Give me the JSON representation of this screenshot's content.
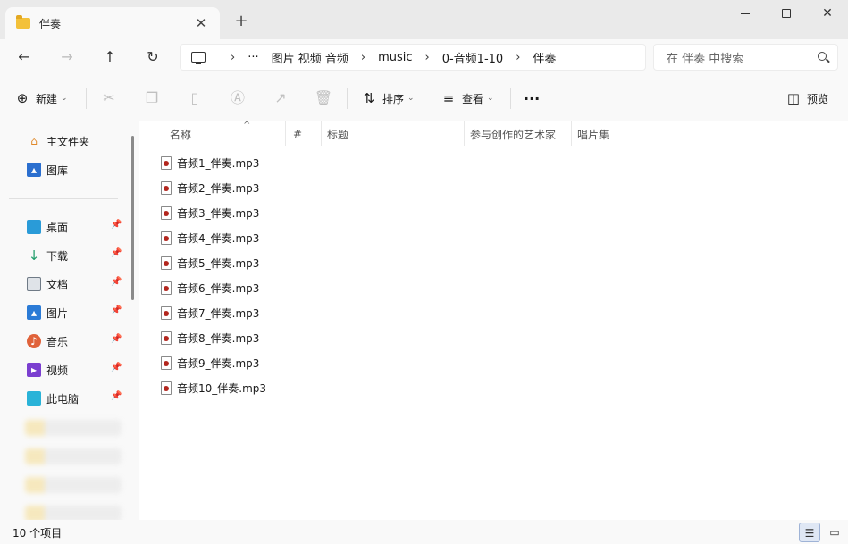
{
  "window": {
    "tab_title": "伴奏",
    "tab_close": "✕",
    "new_tab": "+",
    "minimize": "",
    "maximize": "",
    "close": "✕"
  },
  "nav": {
    "back": "←",
    "forward": "→",
    "up": "↑",
    "refresh": "↻",
    "breadcrumbs": [
      "图片 视频 音频",
      "music",
      "0-音频1-10",
      "伴奏"
    ],
    "overflow": "···",
    "search_placeholder": "在 伴奏 中搜索"
  },
  "toolbar": {
    "new_label": "新建",
    "sort_label": "排序",
    "view_label": "查看",
    "more": "···",
    "preview_label": "预览"
  },
  "sidebar": {
    "top_items": [
      {
        "label": "主文件夹",
        "icon": "home-icon",
        "color": "#e0892b"
      },
      {
        "label": "图库",
        "icon": "gallery-icon",
        "color": "#2b6fcf"
      }
    ],
    "pinned_items": [
      {
        "label": "桌面",
        "icon": "desktop-icon",
        "color": "#2a9bd8"
      },
      {
        "label": "下载",
        "icon": "download-icon",
        "color": "#1f9d6a"
      },
      {
        "label": "文档",
        "icon": "document-icon",
        "color": "#6f7a86"
      },
      {
        "label": "图片",
        "icon": "pictures-icon",
        "color": "#2b7bd6"
      },
      {
        "label": "音乐",
        "icon": "music-icon",
        "color": "#e0623a"
      },
      {
        "label": "视频",
        "icon": "video-icon",
        "color": "#7b3fd0"
      },
      {
        "label": "此电脑",
        "icon": "this-pc-icon",
        "color": "#2ab3d8"
      }
    ]
  },
  "columns": [
    "名称",
    "#",
    "标题",
    "参与创作的艺术家",
    "唱片集"
  ],
  "files": [
    "音频1_伴奏.mp3",
    "音频2_伴奏.mp3",
    "音频3_伴奏.mp3",
    "音频4_伴奏.mp3",
    "音频5_伴奏.mp3",
    "音频6_伴奏.mp3",
    "音频7_伴奏.mp3",
    "音频8_伴奏.mp3",
    "音频9_伴奏.mp3",
    "音频10_伴奏.mp3"
  ],
  "status": {
    "count": "10 个项目"
  }
}
